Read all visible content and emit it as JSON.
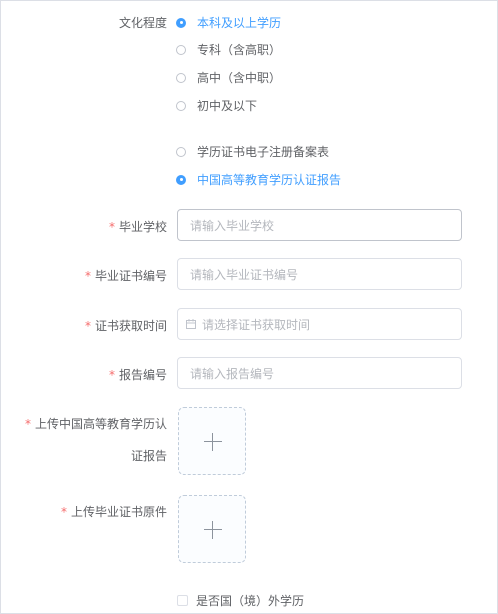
{
  "education": {
    "label": "文化程度",
    "options": [
      {
        "label": "本科及以上学历",
        "checked": true
      },
      {
        "label": "专科（含高职）",
        "checked": false
      },
      {
        "label": "高中（含中职）",
        "checked": false
      },
      {
        "label": "初中及以下",
        "checked": false
      }
    ]
  },
  "certificate_type": {
    "options": [
      {
        "label": "学历证书电子注册备案表",
        "checked": false
      },
      {
        "label": "中国高等教育学历认证报告",
        "checked": true
      }
    ]
  },
  "fields": {
    "school": {
      "label": "毕业学校",
      "placeholder": "请输入毕业学校"
    },
    "cert_number": {
      "label": "毕业证书编号",
      "placeholder": "请输入毕业证书编号"
    },
    "cert_date": {
      "label": "证书获取时间",
      "placeholder": "请选择证书获取时间"
    },
    "report_number": {
      "label": "报告编号",
      "placeholder": "请输入报告编号"
    }
  },
  "uploads": {
    "report": {
      "label_line1": "上传中国高等教育学历认",
      "label_line2": "证报告",
      "icon": "plus-icon"
    },
    "original": {
      "label": "上传毕业证书原件",
      "icon": "plus-icon"
    }
  },
  "foreign_degree": {
    "label": "是否国（境）外学历",
    "checked": false
  },
  "required_mark": "*",
  "colors": {
    "accent": "#409eff",
    "required": "#f56c6c",
    "border": "#dcdfe6",
    "placeholder": "#b4b7bd"
  }
}
